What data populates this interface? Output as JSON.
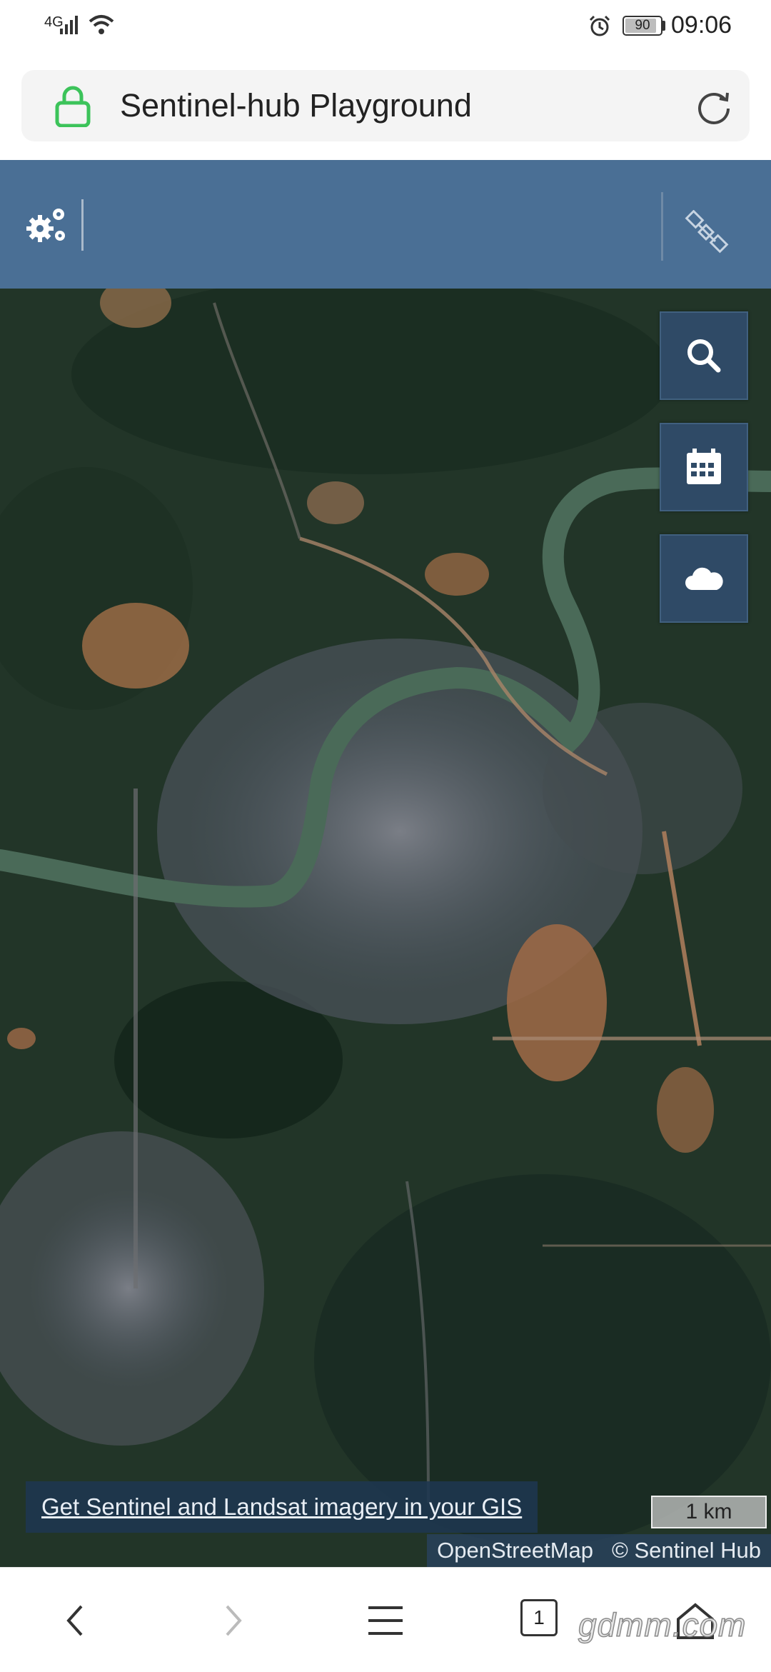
{
  "status_bar": {
    "network": "4G",
    "battery": "90",
    "battery_level": 0.9,
    "time": "09:06",
    "icons": [
      "signal-icon",
      "wifi-icon",
      "alarm-icon",
      "battery-icon"
    ]
  },
  "browser": {
    "page_title": "Sentinel-hub Playground",
    "icons": [
      "lock-icon",
      "reload-icon"
    ]
  },
  "app_bar": {
    "icons": [
      "settings-icon",
      "satellite-icon"
    ]
  },
  "map": {
    "tools": [
      {
        "name": "search",
        "icon": "search-icon"
      },
      {
        "name": "date",
        "icon": "calendar-icon"
      },
      {
        "name": "cloud-coverage",
        "icon": "cloud-icon"
      }
    ],
    "gis_link": "Get Sentinel and Landsat imagery in your GIS",
    "scale": "1 km",
    "attribution": {
      "osm": "OpenStreetMap",
      "sentinel": "© Sentinel Hub"
    }
  },
  "bottom_nav": {
    "tab_count": "1",
    "icons": [
      "back-icon",
      "forward-icon",
      "menu-icon",
      "tabs-icon",
      "home-icon"
    ]
  },
  "watermark": "gdmm.com",
  "colors": {
    "app_bar": "#4a6f95",
    "map_button": "#2f4a66",
    "lock": "#3cc35a"
  }
}
